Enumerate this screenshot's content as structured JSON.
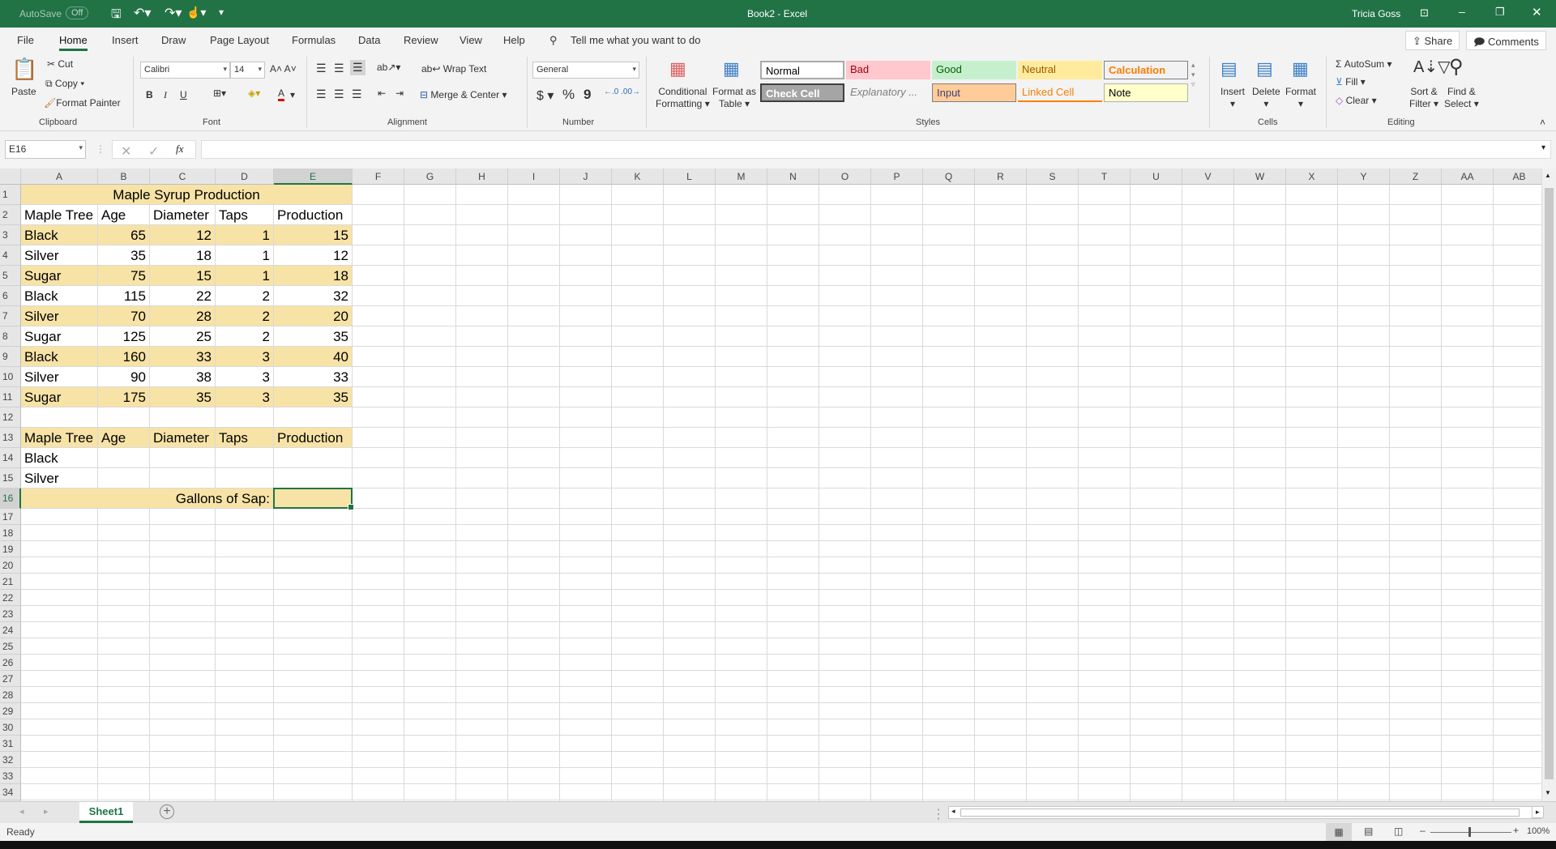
{
  "titlebar": {
    "autosave_label": "AutoSave",
    "autosave_state": "Off",
    "title": "Book2  -  Excel",
    "user": "Tricia Goss",
    "accent": "#217346"
  },
  "menu": {
    "tabs": [
      "File",
      "Home",
      "Insert",
      "Draw",
      "Page Layout",
      "Formulas",
      "Data",
      "Review",
      "View",
      "Help"
    ],
    "active": "Home",
    "tell_me": "Tell me what you want to do",
    "share": "Share",
    "comments": "Comments"
  },
  "ribbon": {
    "clipboard": {
      "label": "Clipboard",
      "paste": "Paste",
      "cut": "Cut",
      "copy": "Copy",
      "format_painter": "Format Painter"
    },
    "font": {
      "label": "Font",
      "name": "Calibri",
      "size": "14",
      "bold": "B",
      "italic": "I",
      "underline": "U",
      "font_color": "#e00000"
    },
    "alignment": {
      "label": "Alignment",
      "wrap_text": "Wrap Text",
      "merge_center": "Merge & Center"
    },
    "number": {
      "label": "Number",
      "format": "General",
      "currency": "$",
      "percent": "%",
      "comma": "9"
    },
    "styles": {
      "label": "Styles",
      "conditional": "Conditional",
      "conditional2": "Formatting",
      "format_as": "Format as",
      "format_as2": "Table",
      "items": [
        {
          "name": "Normal",
          "bg": "#ffffff",
          "fg": "#000000"
        },
        {
          "name": "Bad",
          "bg": "#ffc7ce",
          "fg": "#9c0006"
        },
        {
          "name": "Good",
          "bg": "#c6efce",
          "fg": "#006100"
        },
        {
          "name": "Neutral",
          "bg": "#ffeb9c",
          "fg": "#9c5700"
        },
        {
          "name": "Calculation",
          "bg": "#f2f2f2",
          "fg": "#fa7d00"
        },
        {
          "name": "Check Cell",
          "bg": "#a5a5a5",
          "fg": "#ffffff"
        },
        {
          "name": "Explanatory ...",
          "bg": "#f3f3f3",
          "fg": "#7f7f7f"
        },
        {
          "name": "Input",
          "bg": "#ffcc99",
          "fg": "#3f3f76"
        },
        {
          "name": "Linked Cell",
          "bg": "#f3f3f3",
          "fg": "#fa7d00"
        },
        {
          "name": "Note",
          "bg": "#ffffcc",
          "fg": "#000000"
        }
      ]
    },
    "cells": {
      "label": "Cells",
      "insert": "Insert",
      "delete": "Delete",
      "format": "Format"
    },
    "editing": {
      "label": "Editing",
      "autosum": "AutoSum",
      "fill": "Fill",
      "clear": "Clear",
      "sort": "Sort &",
      "sort2": "Filter",
      "find": "Find &",
      "find2": "Select"
    }
  },
  "formula_bar": {
    "name_box": "E16",
    "fx": "fx",
    "value": ""
  },
  "sheet": {
    "columns": [
      "A",
      "B",
      "C",
      "D",
      "E",
      "F",
      "G",
      "H",
      "I",
      "J",
      "K",
      "L",
      "M",
      "N",
      "O",
      "P",
      "Q",
      "R",
      "S",
      "T",
      "U",
      "V",
      "W",
      "X",
      "Y",
      "Z",
      "AA",
      "AB"
    ],
    "selected_cell": "E16",
    "fill_color": "#f7e3a6",
    "title": "Maple Syrup Production",
    "headers": [
      "Maple Tree",
      "Age",
      "Diameter",
      "Taps",
      "Production"
    ],
    "rows": [
      [
        "Black",
        65,
        12,
        1,
        15
      ],
      [
        "Silver",
        35,
        18,
        1,
        12
      ],
      [
        "Sugar",
        75,
        15,
        1,
        18
      ],
      [
        "Black",
        115,
        22,
        2,
        32
      ],
      [
        "Silver",
        70,
        28,
        2,
        20
      ],
      [
        "Sugar",
        125,
        25,
        2,
        35
      ],
      [
        "Black",
        160,
        33,
        3,
        40
      ],
      [
        "Silver",
        90,
        38,
        3,
        33
      ],
      [
        "Sugar",
        175,
        35,
        3,
        35
      ]
    ],
    "headers2": [
      "Maple Tree",
      "Age",
      "Diameter",
      "Taps",
      "Production"
    ],
    "criteria": [
      "Black",
      "Silver"
    ],
    "result_label": "Gallons of Sap:"
  },
  "tabs": {
    "sheets": [
      "Sheet1"
    ],
    "active": "Sheet1"
  },
  "status": {
    "text": "Ready",
    "zoom": "100%"
  }
}
